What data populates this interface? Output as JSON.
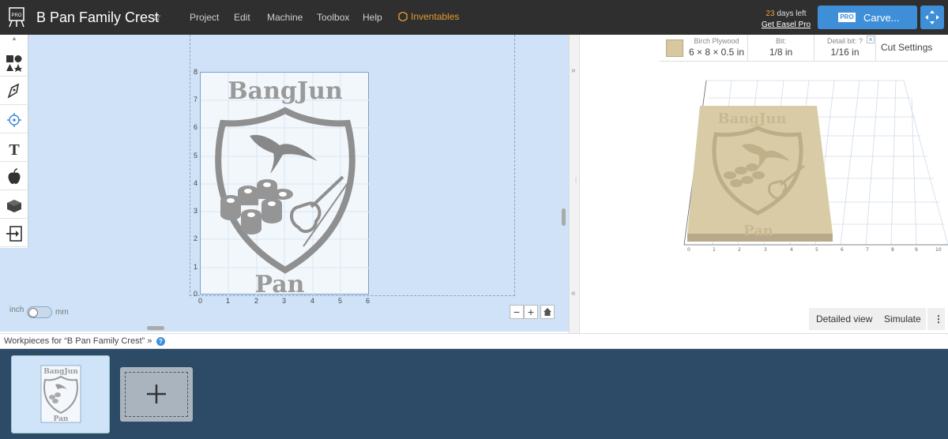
{
  "header": {
    "title": "B Pan Family Crest",
    "menu": [
      "Project",
      "Edit",
      "Machine",
      "Toolbox",
      "Help"
    ],
    "inventables": "Inventables",
    "trial_days": "23",
    "trial_suffix": " days left",
    "get_pro": "Get Easel Pro",
    "pro_badge": "PRO",
    "carve_label": "Carve..."
  },
  "design": {
    "top_text": "BangJun",
    "bottom_text": "Pan",
    "y_ticks": [
      "0",
      "1",
      "2",
      "3",
      "4",
      "5",
      "6",
      "7",
      "8"
    ],
    "x_ticks": [
      "0",
      "1",
      "2",
      "3",
      "4",
      "5",
      "6"
    ]
  },
  "units": {
    "left": "inch",
    "right": "mm"
  },
  "settings": {
    "material_name": "Birch Plywood",
    "material_size": "6 × 8 × 0.5 in",
    "bit_label": "Bit:",
    "bit_value": "1/8 in",
    "detail_bit_label": "Detail bit:",
    "detail_bit_value": "1/16 in",
    "cut_settings": "Cut Settings",
    "material_color": "#d8c8a0"
  },
  "preview": {
    "detailed_view": "Detailed view",
    "simulate": "Simulate",
    "x_ticks": [
      "0",
      "1",
      "2",
      "3",
      "4",
      "5",
      "6",
      "7",
      "8",
      "9",
      "10"
    ]
  },
  "workpieces": {
    "label": "Workpieces for “B Pan Family Crest”",
    "thumb_top": "BangJun",
    "thumb_bottom": "Pan"
  },
  "colors": {
    "accent": "#3f8fd8",
    "topbar": "#2f2f2f",
    "canvas_bg": "#cfe2f7",
    "bottom_bg": "#2d4b67",
    "inventables": "#e39b2e"
  }
}
